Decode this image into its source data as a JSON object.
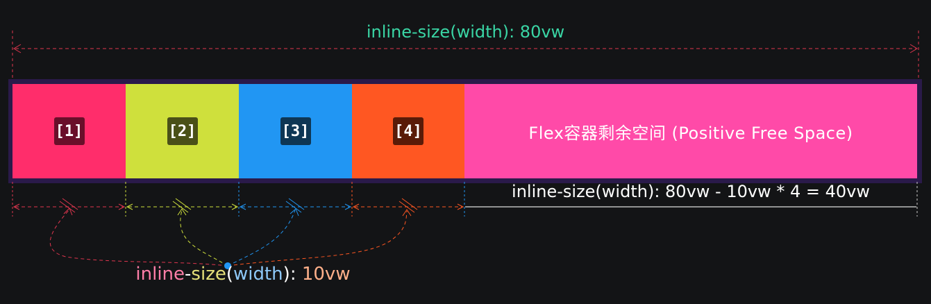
{
  "title_label": "inline-size(width): 80vw",
  "items": [
    {
      "label": "[1]",
      "color": "#ff2d6b",
      "badge": "#6a0f2a"
    },
    {
      "label": "[2]",
      "color": "#cfe03c",
      "badge": "#4a5018"
    },
    {
      "label": "[3]",
      "color": "#2196f3",
      "badge": "#0e3654"
    },
    {
      "label": "[4]",
      "color": "#ff5722",
      "badge": "#5a1b08"
    }
  ],
  "free_space_label": "Flex容器剩余空间 (Positive Free Space)",
  "free_space_color": "#ff4aa8",
  "remaining_label": "inline-size(width): 80vw - 10vw * 4 = 40vw",
  "item_width_label": {
    "parts": [
      {
        "text": "inline",
        "color": "#ff7ea8"
      },
      {
        "text": "-",
        "color": "#ffffff"
      },
      {
        "text": "size",
        "color": "#e6e07a"
      },
      {
        "text": "(",
        "color": "#ffffff"
      },
      {
        "text": "width",
        "color": "#8ec8f8"
      },
      {
        "text": "): ",
        "color": "#ffffff"
      },
      {
        "text": "10vw",
        "color": "#ffb08a"
      }
    ]
  },
  "colors": {
    "title": "#3ad6a5",
    "container_border": "#2a1a4a",
    "background": "#131416"
  }
}
